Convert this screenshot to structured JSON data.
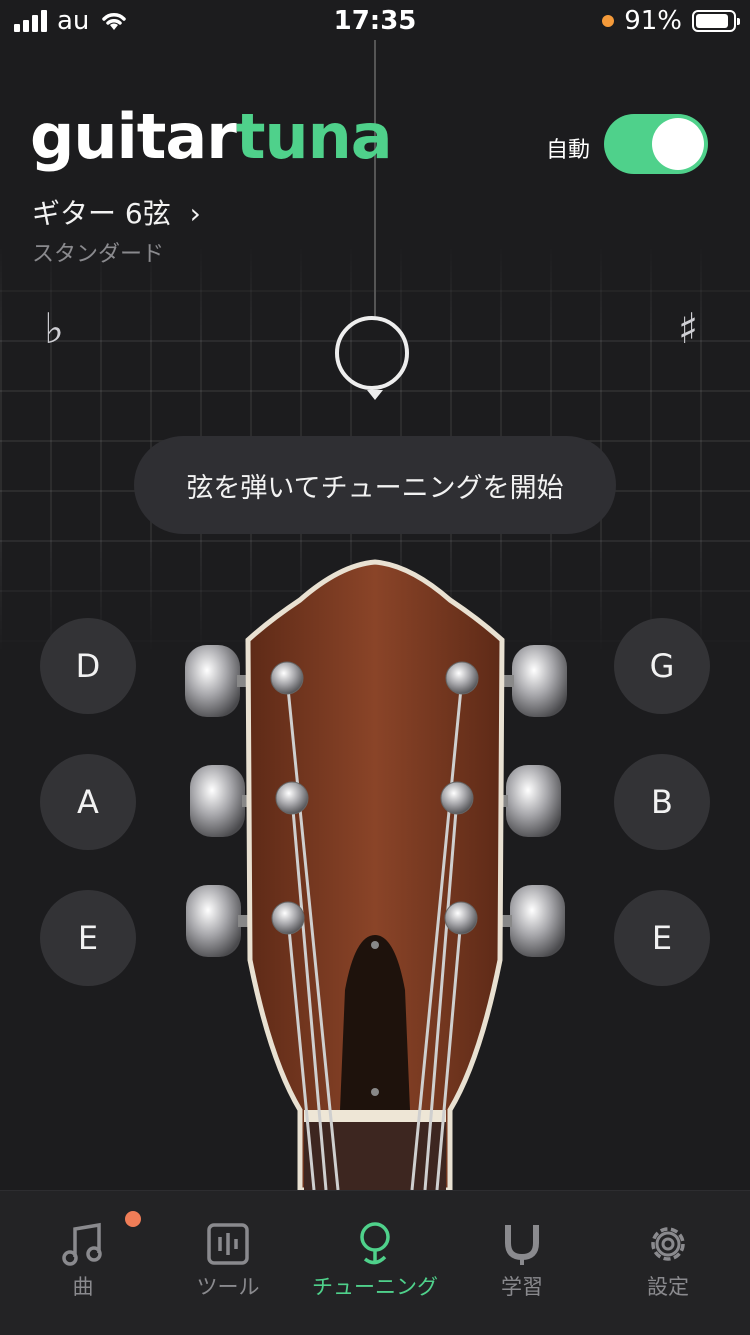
{
  "status": {
    "carrier": "au",
    "time": "17:35",
    "battery": "91%"
  },
  "header": {
    "logo_a": "guitar",
    "logo_b": "tuna",
    "auto_label": "自動",
    "auto_on": true,
    "tuning_name": "ギター 6弦",
    "tuning_sub": "スタンダード"
  },
  "tuner": {
    "flat": "♭",
    "sharp": "♯",
    "prompt": "弦を弾いてチューニングを開始"
  },
  "strings": {
    "left": [
      "D",
      "A",
      "E"
    ],
    "right": [
      "G",
      "B",
      "E"
    ]
  },
  "tabs": [
    {
      "label": "曲",
      "icon": "music-note-icon"
    },
    {
      "label": "ツール",
      "icon": "tools-icon"
    },
    {
      "label": "チューニング",
      "icon": "tuner-icon"
    },
    {
      "label": "学習",
      "icon": "learn-icon"
    },
    {
      "label": "設定",
      "icon": "gear-icon"
    }
  ],
  "colors": {
    "accent": "#4fd18b",
    "badge": "#ef7d57",
    "background": "#1c1c1e",
    "wood": "#7a3a22"
  }
}
